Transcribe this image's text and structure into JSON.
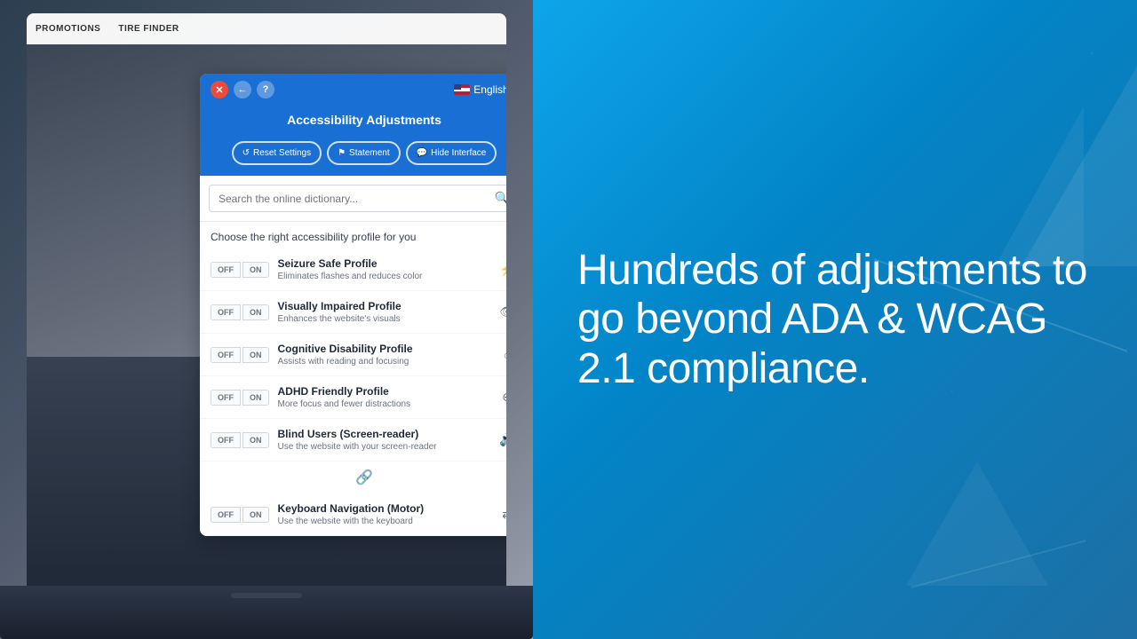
{
  "left": {
    "nav": {
      "items": [
        "PROMOTIONS",
        "TIRE FINDER"
      ]
    }
  },
  "panel": {
    "close_btn": "✕",
    "back_btn": "←",
    "help_btn": "?",
    "language": "English ˅",
    "title": "Accessibility Adjustments",
    "actions": {
      "reset": "Reset Settings",
      "statement": "Statement",
      "hide": "Hide Interface"
    },
    "search": {
      "placeholder": "Search the online dictionary...",
      "icon": "🔍"
    },
    "profile_section_title": "Choose the right accessibility profile for you",
    "profiles": [
      {
        "name": "Seizure Safe Profile",
        "desc": "Eliminates flashes and reduces color",
        "icon": "⚡"
      },
      {
        "name": "Visually Impaired Profile",
        "desc": "Enhances the website's visuals",
        "icon": "👁"
      },
      {
        "name": "Cognitive Disability Profile",
        "desc": "Assists with reading and focusing",
        "icon": "○"
      },
      {
        "name": "ADHD Friendly Profile",
        "desc": "More focus and fewer distractions",
        "icon": "⊕"
      },
      {
        "name": "Blind Users (Screen-reader)",
        "desc": "Use the website with your screen-reader",
        "icon": "🔊"
      },
      {
        "name": "Keyboard Navigation (Motor)",
        "desc": "Use the website with the keyboard",
        "icon": "⇄"
      }
    ],
    "toggle_off": "OFF",
    "toggle_on": "ON"
  },
  "right": {
    "hero_text": "Hundreds of adjustments to go beyond ADA & WCAG 2.1 compliance."
  },
  "colors": {
    "panel_blue": "#1a6fd4",
    "right_bg_start": "#0ea5e9",
    "right_bg_end": "#1d6fa4"
  }
}
